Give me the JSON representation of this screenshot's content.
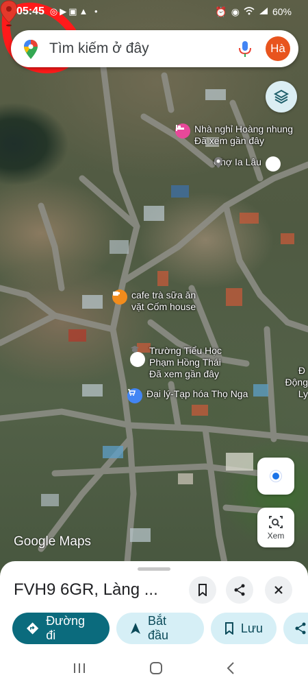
{
  "status": {
    "time": "05:45",
    "battery": "60%"
  },
  "search": {
    "placeholder": "Tìm kiếm ở đây",
    "avatar_initial": "Hà"
  },
  "places": [
    {
      "name": "Nhà nghỉ Hoàng nhung",
      "sub": "Đã xem gần đây",
      "icon": "bed-icon",
      "color": "#e8489a"
    },
    {
      "name": "Chợ Ia Lâu",
      "sub": "",
      "icon": "pin-icon",
      "color": "#7a7a7a"
    },
    {
      "name": "cafe trà sữa ăn",
      "sub": "vặt Cốm house",
      "icon": "coffee-icon",
      "color": "#f28c1c"
    },
    {
      "name": "Trường Tiểu Học",
      "name2": "Phạm Hồng Thái",
      "sub": "Đã xem gần đây",
      "icon": "school-icon",
      "color": "#7a7a7a"
    },
    {
      "name": "Đại lý-Tạp hóa Thọ Nga",
      "sub": "",
      "icon": "cart-icon",
      "color": "#4285f4"
    },
    {
      "name": "Đ",
      "sub": "Động Ly",
      "icon": "pin-icon",
      "color": "#7a7a7a"
    }
  ],
  "map": {
    "watermark": "Google Maps",
    "lens_label": "Xem"
  },
  "sheet": {
    "title": "FVH9 6GR, Làng ...",
    "chips": [
      {
        "label": "Đường đi",
        "icon": "directions-icon"
      },
      {
        "label": "Bắt đầu",
        "icon": "navigation-icon"
      },
      {
        "label": "Lưu",
        "icon": "bookmark-icon"
      }
    ]
  },
  "colors": {
    "accent": "#0b6b7d",
    "chip_bg": "#d6eff6",
    "avatar": "#e8541e",
    "annotation": "#ff1a1a"
  }
}
